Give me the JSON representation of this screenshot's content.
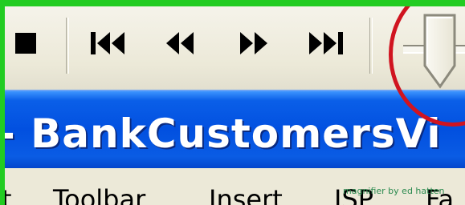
{
  "window": {
    "title": "- BankCustomersVi"
  },
  "toolbar": {
    "buttons": [
      {
        "icon": "stop-icon"
      },
      {
        "icon": "first-record-icon"
      },
      {
        "icon": "previous-record-icon"
      },
      {
        "icon": "next-record-icon"
      },
      {
        "icon": "last-record-icon"
      }
    ],
    "slider": {
      "icon": "slider-thumb-icon"
    }
  },
  "menubar": {
    "items": [
      {
        "label": "t"
      },
      {
        "label": "Toolbar"
      },
      {
        "label": "Insert"
      },
      {
        "label": "ISP"
      },
      {
        "label": "Fa"
      }
    ]
  },
  "watermark": "magnifier by ed hatten",
  "colors": {
    "frame": "#22cc22",
    "titlebar": "#0250e0",
    "annotation": "#d01420",
    "toolbar_bg": "#ece9d8"
  }
}
